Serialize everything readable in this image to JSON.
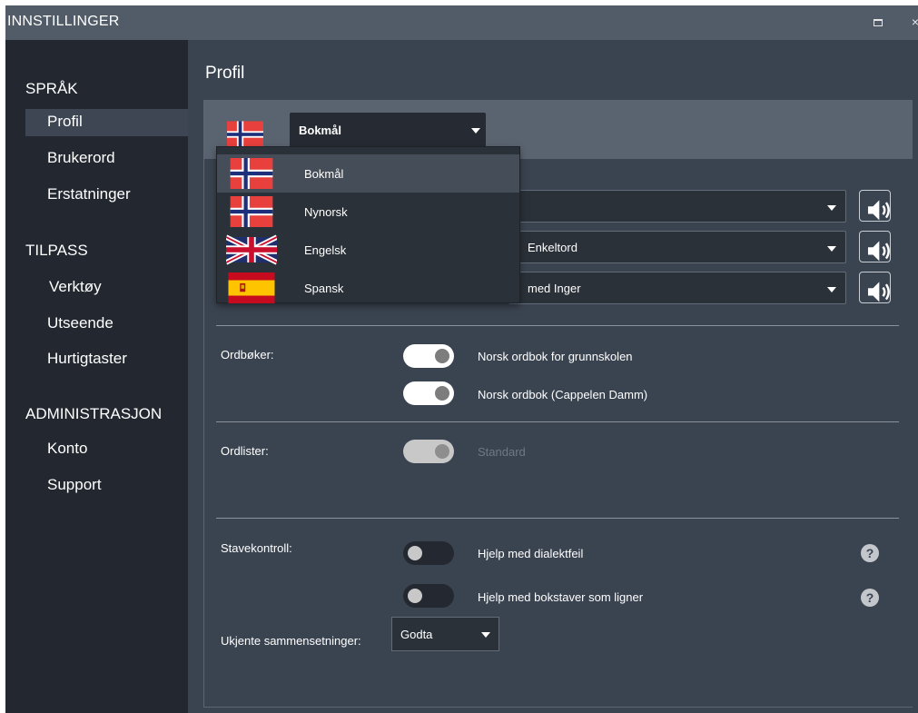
{
  "window": {
    "title": "INNSTILLINGER",
    "maximize_icon": "maximize-icon",
    "close_glyph": "×"
  },
  "sidebar": {
    "sections": [
      {
        "label": "SPRÅK",
        "items": [
          {
            "label": "Profil",
            "active": true
          },
          {
            "label": "Brukerord"
          },
          {
            "label": "Erstatninger"
          }
        ]
      },
      {
        "label": "TILPASS",
        "items": [
          {
            "label": "Verktøy"
          },
          {
            "label": "Utseende"
          },
          {
            "label": "Hurtigtaster"
          }
        ]
      },
      {
        "label": "ADMINISTRASJON",
        "items": [
          {
            "label": "Konto"
          },
          {
            "label": "Support"
          }
        ]
      }
    ]
  },
  "main": {
    "title": "Profil",
    "language_select": {
      "value": "Bokmål",
      "flag": "norway-flag"
    },
    "language_dropdown": {
      "options": [
        {
          "label": "Bokmål",
          "flag": "norway-flag",
          "hovered": true
        },
        {
          "label": "Nynorsk",
          "flag": "norway-flag"
        },
        {
          "label": "Engelsk",
          "flag": "uk-flag"
        },
        {
          "label": "Spansk",
          "flag": "spain-flag"
        }
      ]
    },
    "speech_rows": [
      {
        "value": ""
      },
      {
        "value": "Enkeltord"
      },
      {
        "value": "med Inger"
      }
    ],
    "ordboker": {
      "label": "Ordbøker:",
      "items": [
        {
          "label": "Norsk ordbok for grunnskolen",
          "state": "on"
        },
        {
          "label": "Norsk ordbok (Cappelen Damm)",
          "state": "on"
        }
      ]
    },
    "ordlister": {
      "label": "Ordlister:",
      "items": [
        {
          "label": "Standard",
          "state": "disabled"
        }
      ]
    },
    "stavekontroll": {
      "label": "Stavekontroll:",
      "items": [
        {
          "label": "Hjelp med dialektfeil",
          "state": "off",
          "help": "?"
        },
        {
          "label": "Hjelp med bokstaver som ligner",
          "state": "off",
          "help": "?"
        }
      ]
    },
    "unknown_compounds": {
      "label": "Ukjente sammensetninger:",
      "value": "Godta"
    }
  },
  "colors": {
    "sidebar_bg": "#232830",
    "content_bg": "#3a4350",
    "titlebar_bg": "#525c68",
    "panel_header_bg": "#5a6470",
    "dropdown_bg": "#2b3139",
    "toggle_on": "#ffffff",
    "toggle_off": "#242830"
  }
}
